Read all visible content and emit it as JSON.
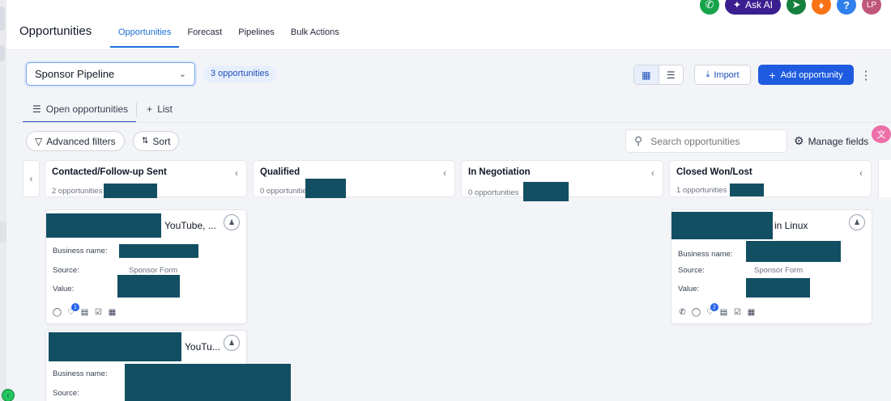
{
  "header": {
    "title": "Opportunities",
    "tabs": [
      {
        "label": "Opportunities",
        "active": true
      },
      {
        "label": "Forecast",
        "active": false
      },
      {
        "label": "Pipelines",
        "active": false
      },
      {
        "label": "Bulk Actions",
        "active": false
      }
    ],
    "ask_ai_label": "Ask AI",
    "avatar_initials": "LP",
    "help_glyph": "?"
  },
  "toolbar": {
    "pipeline_value": "Sponsor Pipeline",
    "opportunity_count": "3 opportunities",
    "import_label": "Import",
    "add_label": "Add opportunity"
  },
  "subtabs": {
    "open_label": "Open opportunities",
    "list_label": "List"
  },
  "filters": {
    "advanced_label": "Advanced filters",
    "sort_label": "Sort",
    "search_placeholder": "Search opportunities",
    "manage_fields_label": "Manage fields"
  },
  "columns": [
    {
      "name": "Contacted/Follow-up Sent",
      "count": "2 opportunities"
    },
    {
      "name": "Qualified",
      "count": "0 opportunities"
    },
    {
      "name": "In Negotiation",
      "count": "0 opportunities"
    },
    {
      "name": "Closed Won/Lost",
      "count": "1 opportunities"
    }
  ],
  "labels": {
    "business_name": "Business name:",
    "source": "Source:",
    "value": "Value:"
  },
  "cards": [
    {
      "title_suffix": "YouTube, ...",
      "source": "Sponsor Form",
      "badge": "1"
    },
    {
      "title_suffix": "YouTu...",
      "source": ""
    },
    {
      "title_suffix": "in Linux",
      "source": "Sponsor Form",
      "badge": "2"
    }
  ],
  "colors": {
    "accent": "#1d6fd8",
    "primary_button": "#1f5be0",
    "redaction": "#134f63",
    "ask_ai": "#3b1f91"
  }
}
